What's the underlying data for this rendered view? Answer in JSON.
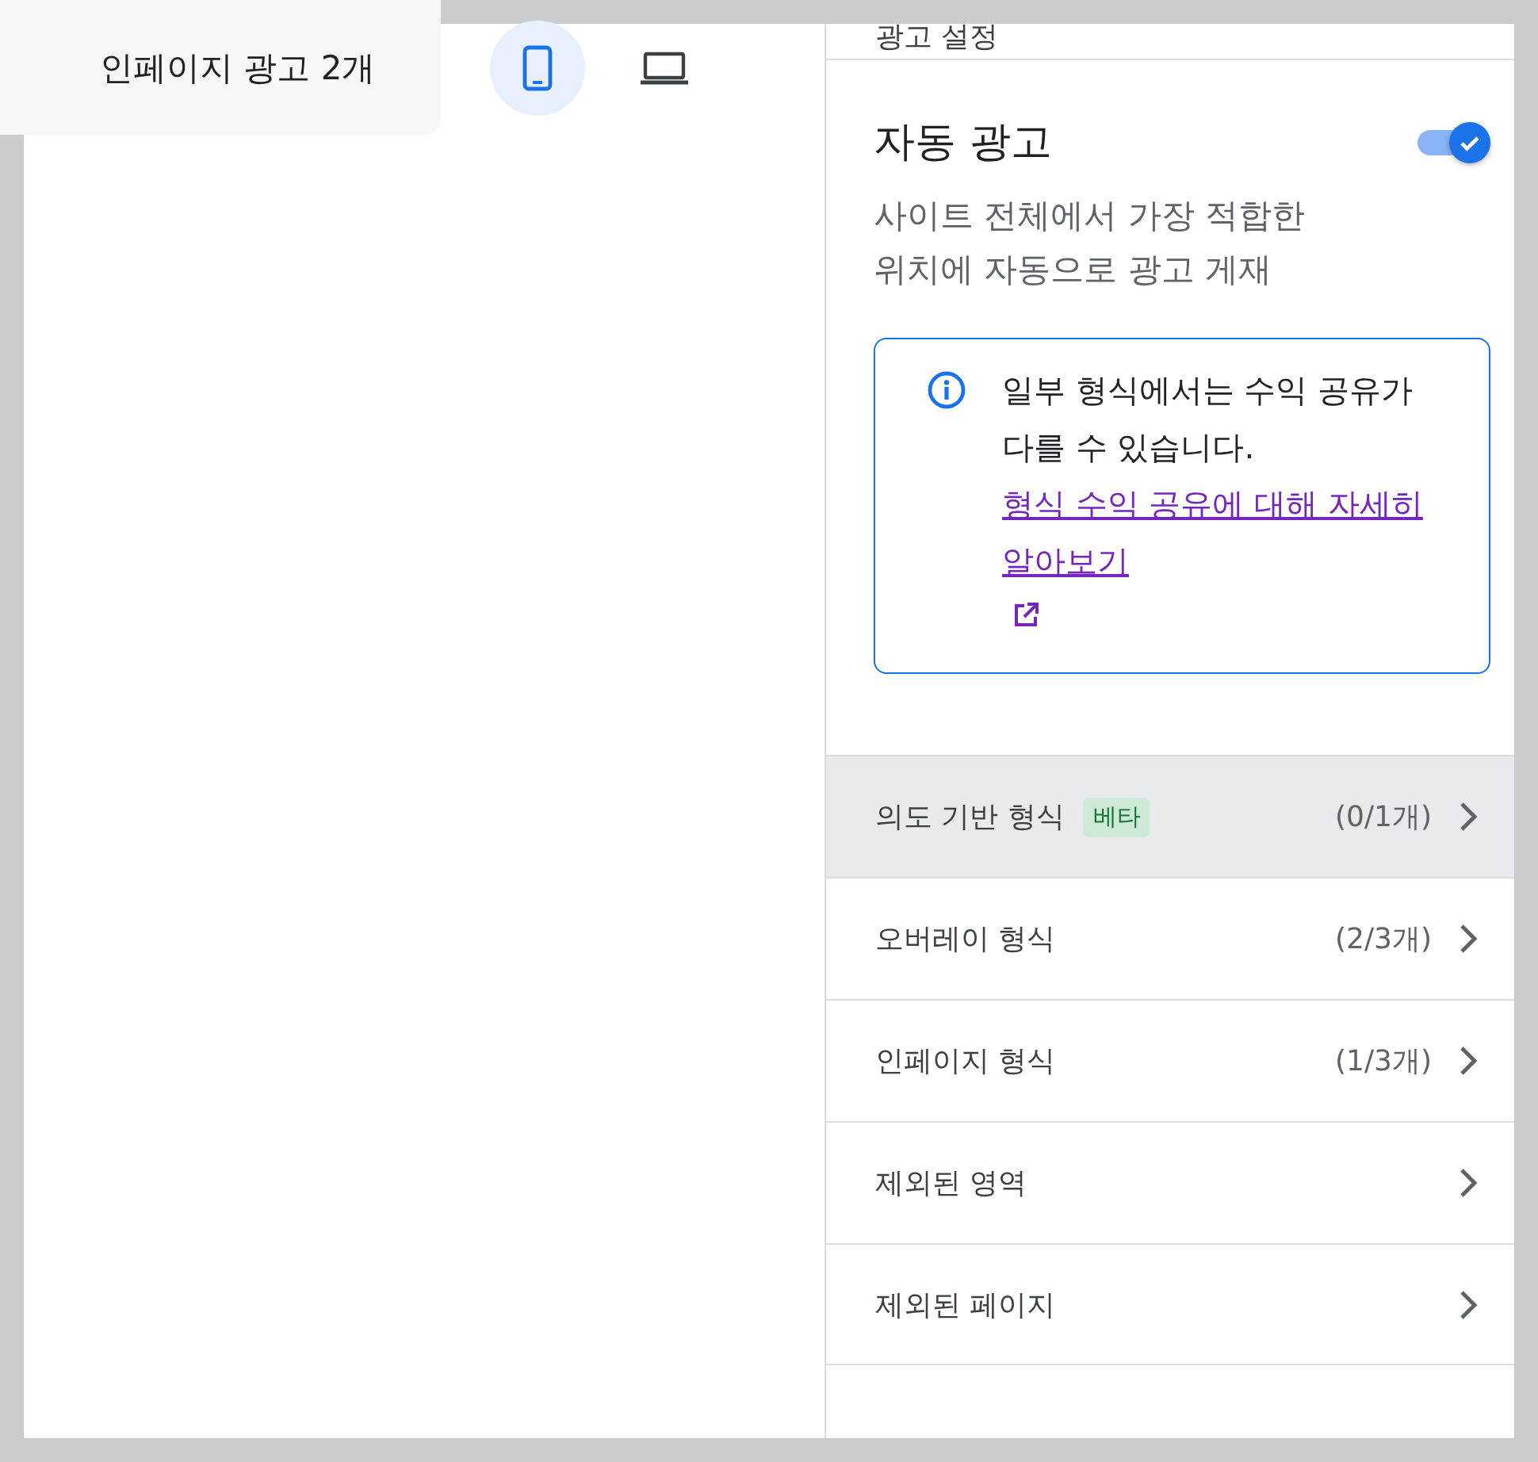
{
  "preview": {
    "title": "인페이지 광고 2개",
    "devices": [
      {
        "kind": "mobile",
        "selected": true
      },
      {
        "kind": "laptop",
        "selected": false
      }
    ]
  },
  "panel": {
    "title": "광고 설정",
    "auto_ads": {
      "title": "자동 광고",
      "on": true,
      "description": "사이트 전체에서 가장 적합한 위치에 자동으로 광고 게재"
    },
    "notice": {
      "text": "일부 형식에서는 수익 공유가 다를 수 있습니다.",
      "link": "형식 수익 공유에 대해 자세히 알아보기"
    },
    "items": [
      {
        "label": "의도 기반 형식",
        "badge": "베타",
        "count": "(0/1개)",
        "selected": true
      },
      {
        "label": "오버레이 형식",
        "count": "(2/3개)",
        "selected": false
      },
      {
        "label": "인페이지 형식",
        "count": "(1/3개)",
        "selected": false
      },
      {
        "label": "제외된 영역",
        "selected": false
      },
      {
        "label": "제외된 페이지",
        "selected": false
      }
    ]
  }
}
